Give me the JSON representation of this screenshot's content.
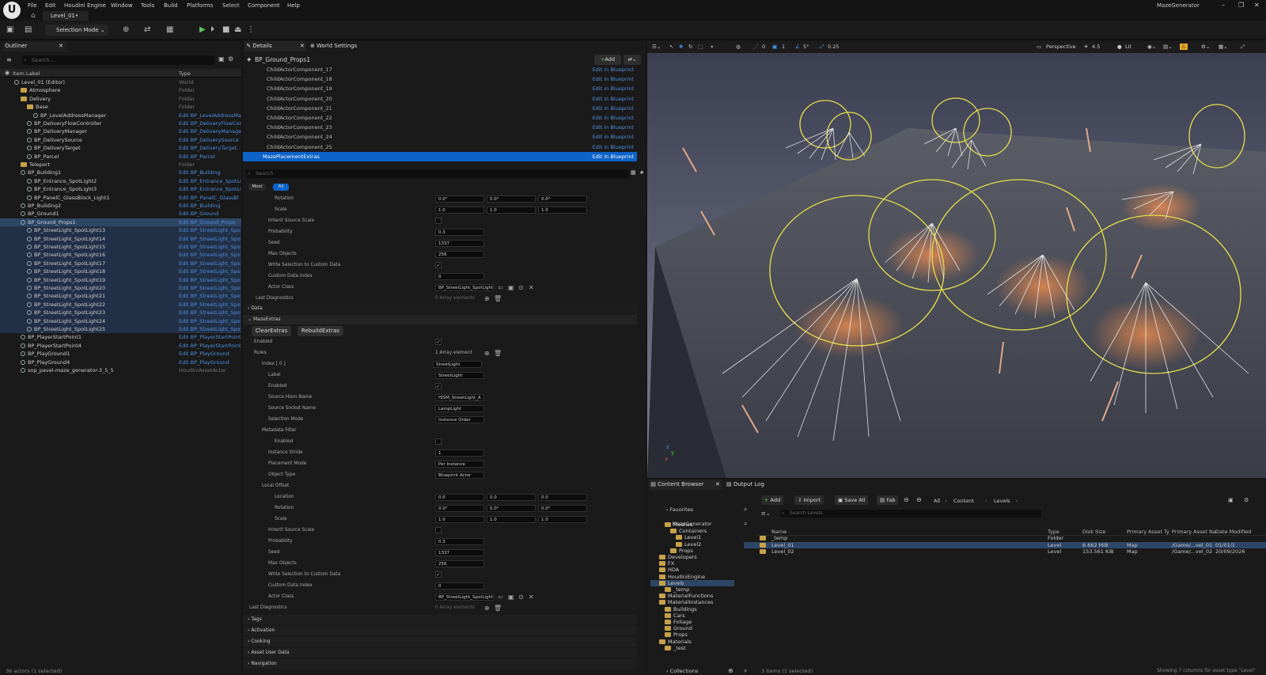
{
  "menu": [
    "File",
    "Edit",
    "Houdini Engine",
    "Window",
    "Tools",
    "Build",
    "Platforms",
    "Select",
    "Component",
    "Help"
  ],
  "level_tab": "Level_01•",
  "app_title": "MazeGenerator",
  "toolbar": {
    "selection_mode": "Selection Mode"
  },
  "outliner": {
    "tab": "Outliner",
    "search_placeholder": "Search...",
    "col_label": "Item Label",
    "col_type": "Type",
    "rows": [
      {
        "label": "Level_01 (Editor)",
        "type": "World",
        "indent": 1,
        "kind": "actor"
      },
      {
        "label": "Atmosphere",
        "type": "Folder",
        "indent": 2,
        "kind": "folder"
      },
      {
        "label": "Delivery",
        "type": "Folder",
        "indent": 2,
        "kind": "folder"
      },
      {
        "label": "Base",
        "type": "Folder",
        "indent": 3,
        "kind": "folder"
      },
      {
        "label": "BP_LevelAddressManager",
        "type": "Edit BP_LevelAddressMa",
        "indent": 4,
        "kind": "actor",
        "link": true
      },
      {
        "label": "BP_DeliveryFlowController",
        "type": "Edit BP_DeliveryFlowCon",
        "indent": 3,
        "kind": "actor",
        "link": true
      },
      {
        "label": "BP_DeliveryManager",
        "type": "Edit BP_DeliveryManage",
        "indent": 3,
        "kind": "actor",
        "link": true
      },
      {
        "label": "BP_DeliverySource",
        "type": "Edit BP_DeliverySource",
        "indent": 3,
        "kind": "actor",
        "link": true
      },
      {
        "label": "BP_DeliveryTarget",
        "type": "Edit BP_DeliveryTarget",
        "indent": 3,
        "kind": "actor",
        "link": true
      },
      {
        "label": "BP_Parcel",
        "type": "Edit BP_Parcel",
        "indent": 3,
        "kind": "actor",
        "link": true
      },
      {
        "label": "Teleport",
        "type": "Folder",
        "indent": 2,
        "kind": "folder"
      },
      {
        "label": "BP_Building1",
        "type": "Edit BP_Building",
        "indent": 2,
        "kind": "actor",
        "link": true
      },
      {
        "label": "BP_Entrance_SpotLight2",
        "type": "Edit BP_Entrance_SpotLi",
        "indent": 3,
        "kind": "actor",
        "link": true
      },
      {
        "label": "BP_Entrance_SpotLight3",
        "type": "Edit BP_Entrance_SpotLi",
        "indent": 3,
        "kind": "actor",
        "link": true
      },
      {
        "label": "BP_PanelC_GlassBlock_Light1",
        "type": "Edit BP_PanelC_GlassBl",
        "indent": 3,
        "kind": "actor",
        "link": true
      },
      {
        "label": "BP_Building2",
        "type": "Edit BP_Building",
        "indent": 2,
        "kind": "actor",
        "link": true
      },
      {
        "label": "BP_Ground1",
        "type": "Edit BP_Ground",
        "indent": 2,
        "kind": "actor",
        "link": true
      },
      {
        "label": "BP_Ground_Props1",
        "type": "Edit BP_Ground_Props",
        "indent": 2,
        "kind": "actor",
        "link": true,
        "selected": true
      },
      {
        "label": "BP_StreetLight_SpotLight13",
        "type": "Edit BP_StreetLight_Spo",
        "indent": 3,
        "kind": "actor",
        "link": true,
        "hl": true
      },
      {
        "label": "BP_StreetLight_SpotLight14",
        "type": "Edit BP_StreetLight_Spo",
        "indent": 3,
        "kind": "actor",
        "link": true,
        "hl": true
      },
      {
        "label": "BP_StreetLight_SpotLight15",
        "type": "Edit BP_StreetLight_Spo",
        "indent": 3,
        "kind": "actor",
        "link": true,
        "hl": true
      },
      {
        "label": "BP_StreetLight_SpotLight16",
        "type": "Edit BP_StreetLight_Spo",
        "indent": 3,
        "kind": "actor",
        "link": true,
        "hl": true
      },
      {
        "label": "BP_StreetLight_SpotLight17",
        "type": "Edit BP_StreetLight_Spo",
        "indent": 3,
        "kind": "actor",
        "link": true,
        "hl": true
      },
      {
        "label": "BP_StreetLight_SpotLight18",
        "type": "Edit BP_StreetLight_Spo",
        "indent": 3,
        "kind": "actor",
        "link": true,
        "hl": true
      },
      {
        "label": "BP_StreetLight_SpotLight19",
        "type": "Edit BP_StreetLight_Spo",
        "indent": 3,
        "kind": "actor",
        "link": true,
        "hl": true
      },
      {
        "label": "BP_StreetLight_SpotLight20",
        "type": "Edit BP_StreetLight_Spo",
        "indent": 3,
        "kind": "actor",
        "link": true,
        "hl": true
      },
      {
        "label": "BP_StreetLight_SpotLight21",
        "type": "Edit BP_StreetLight_Spo",
        "indent": 3,
        "kind": "actor",
        "link": true,
        "hl": true
      },
      {
        "label": "BP_StreetLight_SpotLight22",
        "type": "Edit BP_StreetLight_Spo",
        "indent": 3,
        "kind": "actor",
        "link": true,
        "hl": true
      },
      {
        "label": "BP_StreetLight_SpotLight23",
        "type": "Edit BP_StreetLight_Spo",
        "indent": 3,
        "kind": "actor",
        "link": true,
        "hl": true
      },
      {
        "label": "BP_StreetLight_SpotLight24",
        "type": "Edit BP_StreetLight_Spo",
        "indent": 3,
        "kind": "actor",
        "link": true,
        "hl": true
      },
      {
        "label": "BP_StreetLight_SpotLight25",
        "type": "Edit BP_StreetLight_Spo",
        "indent": 3,
        "kind": "actor",
        "link": true,
        "hl": true
      },
      {
        "label": "BP_PlayerStartPoint1",
        "type": "Edit BP_PlayerStartPoint",
        "indent": 2,
        "kind": "actor",
        "link": true
      },
      {
        "label": "BP_PlayerStartPoint4",
        "type": "Edit BP_PlayerStartPoint",
        "indent": 2,
        "kind": "actor",
        "link": true
      },
      {
        "label": "BP_PlayGround1",
        "type": "Edit BP_PlayGround",
        "indent": 2,
        "kind": "actor",
        "link": true
      },
      {
        "label": "BP_PlayGround4",
        "type": "Edit BP_PlayGround",
        "indent": 2,
        "kind": "actor",
        "link": true
      },
      {
        "label": "sop_pavel-maze_generator-3_5_5",
        "type": "HoudiniAssetActor",
        "indent": 2,
        "kind": "actor"
      }
    ],
    "status": "36 actors (1 selected)"
  },
  "details": {
    "tab": "Details",
    "tab2": "World Settings",
    "actor": "BP_Ground_Props1",
    "add_label": "Add",
    "components": [
      "ChildActorComponent_17",
      "ChildActorComponent_18",
      "ChildActorComponent_19",
      "ChildActorComponent_20",
      "ChildActorComponent_21",
      "ChildActorComponent_22",
      "ChildActorComponent_23",
      "ChildActorComponent_24",
      "ChildActorComponent_25"
    ],
    "edit_bp": "Edit in Blueprint",
    "selected_component": "MazePlacementExtras",
    "search_placeholder": "Search",
    "filter_most": "Most",
    "filter_all": "All",
    "upper": {
      "rotation_label": "Rotation",
      "rotation": [
        "0.0°",
        "0.0°",
        "0.0°"
      ],
      "scale_label": "Scale",
      "scale": [
        "1.0",
        "1.0",
        "1.0"
      ],
      "inherit_label": "Inherit Source Scale",
      "prob_label": "Probability",
      "prob": "0.3",
      "seed_label": "Seed",
      "seed": "1337",
      "max_label": "Max Objects",
      "max": "256",
      "write_label": "Write Selection to Custom Data",
      "cdi_label": "Custom Data Index",
      "cdi": "0",
      "actor_class_label": "Actor Class",
      "actor_class": "BP_StreetLight_SpotLight",
      "last_diag_label": "Last Diagnostics",
      "last_diag": "0 Array elements"
    },
    "sect_data": "Data",
    "sect_maze": "MazeExtras",
    "btn_clear": "ClearExtras",
    "btn_rebuild": "RebuildExtras",
    "enabled_label": "Enabled",
    "rules_label": "Rules",
    "rules_count": "1 Array element",
    "index_label": "Index [ 0 ]",
    "index_value": "StreetLight",
    "rule": {
      "label_label": "Label",
      "label": "StreetLight",
      "enabled_label": "Enabled",
      "hism_label": "Source Hism Name",
      "hism": "HISM_StreetLight_A",
      "socket_label": "Source Socket Name",
      "socket": "LampLight",
      "selmode_label": "Selection Mode",
      "selmode": "Instance Order",
      "meta_label": "Metadata Filter",
      "meta_enabled_label": "Enabled",
      "stride_label": "Instance Stride",
      "stride": "1",
      "pmode_label": "Placement Mode",
      "pmode": "Per Instance",
      "otype_label": "Object Type",
      "otype": "Blueprint Actor",
      "offset_label": "Local Offset",
      "loc_label": "Location",
      "loc": [
        "0.0",
        "0.0",
        "0.0"
      ],
      "rot_label": "Rotation",
      "rot": [
        "0.0°",
        "0.0°",
        "0.0°"
      ],
      "scale_label": "Scale",
      "scale": [
        "1.0",
        "1.0",
        "1.0"
      ],
      "inherit_label": "Inherit Source Scale",
      "prob_label": "Probability",
      "prob": "0.3",
      "seed_label": "Seed",
      "seed": "1337",
      "max_label": "Max Objects",
      "max": "256",
      "write_label": "Write Selection to Custom Data",
      "cdi_label": "Custom Data Index",
      "cdi": "0",
      "actor_class_label": "Actor Class",
      "actor_class": "BP_StreetLight_SpotLight"
    },
    "last_diag_label": "Last Diagnostics",
    "last_diag": "0 Array elements",
    "bottom_sections": [
      "Tags",
      "Activation",
      "Cooking",
      "Asset User Data",
      "Navigation"
    ]
  },
  "viewport": {
    "perspective": "Perspective",
    "lit": "Lit",
    "speed": "4.5",
    "grid": "5°",
    "snap": "0.25",
    "one": "1",
    "zero": "0"
  },
  "content_browser": {
    "tab": "Content Browser",
    "tab2": "Output Log",
    "favorites": "Favorites",
    "root": "MazeGenerator",
    "add": "Add",
    "import": "Import",
    "save_all": "Save All",
    "fab": "Fab",
    "path": [
      "All",
      "Content",
      "Levels"
    ],
    "search_placeholder": "Search Levels",
    "tree": [
      {
        "label": "Meshes",
        "indent": 2
      },
      {
        "label": "Containers",
        "indent": 3
      },
      {
        "label": "Level1",
        "indent": 4
      },
      {
        "label": "Level2",
        "indent": 4
      },
      {
        "label": "Props",
        "indent": 3
      },
      {
        "label": "Developers",
        "indent": 1
      },
      {
        "label": "FX",
        "indent": 1
      },
      {
        "label": "HDA",
        "indent": 1
      },
      {
        "label": "HoudiniEngine",
        "indent": 1
      },
      {
        "label": "Levels",
        "indent": 1,
        "selected": true
      },
      {
        "label": "_temp",
        "indent": 2
      },
      {
        "label": "MaterialFunctions",
        "indent": 1
      },
      {
        "label": "MaterialInstances",
        "indent": 1
      },
      {
        "label": "Buildings",
        "indent": 2
      },
      {
        "label": "Cars",
        "indent": 2
      },
      {
        "label": "Foliage",
        "indent": 2
      },
      {
        "label": "Ground",
        "indent": 2
      },
      {
        "label": "Props",
        "indent": 2
      },
      {
        "label": "Materials",
        "indent": 1
      },
      {
        "label": "_test",
        "indent": 2
      }
    ],
    "collections": "Collections",
    "cols": [
      "Name",
      "Type",
      "Disk Size",
      "Primary Asset Ty",
      "Primary Asset Na",
      "Date Modified"
    ],
    "rows": [
      {
        "name": "_temp",
        "type": "Folder",
        "size": "",
        "pat": "",
        "pan": "",
        "date": ""
      },
      {
        "name": "Level_01",
        "type": "Level",
        "size": "8.662 MiB",
        "pat": "Map",
        "pan": "/Game/...vel_01",
        "date": "01/01/1",
        "selected": true
      },
      {
        "name": "Level_02",
        "type": "Level",
        "size": "153.561 KiB",
        "pat": "Map",
        "pan": "/Game/...vel_02",
        "date": "20/09/2026"
      }
    ],
    "status": "3 items (1 selected)",
    "status_right": "Showing 7 columns for asset type \"Level\""
  }
}
